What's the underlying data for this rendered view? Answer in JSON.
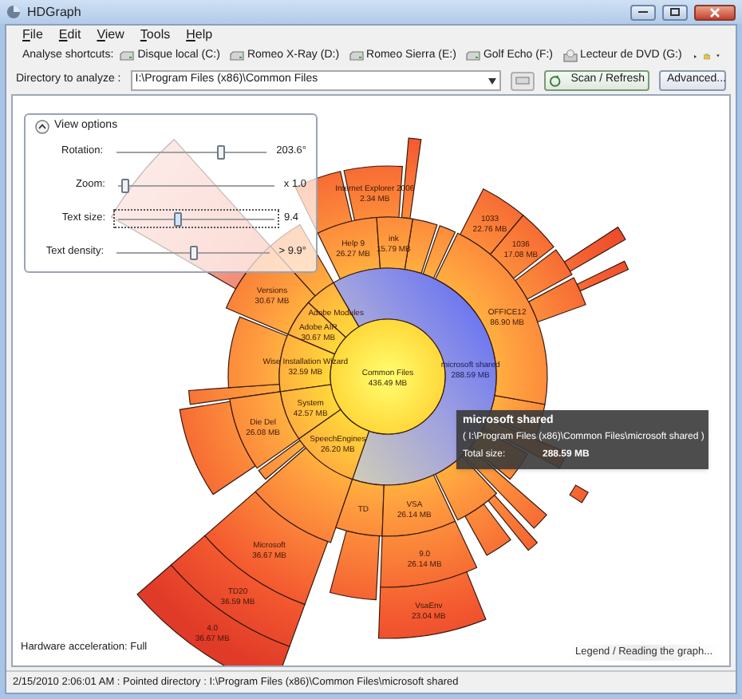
{
  "window": {
    "title": "HDGraph"
  },
  "menu": [
    {
      "label": "File"
    },
    {
      "label": "Edit"
    },
    {
      "label": "View"
    },
    {
      "label": "Tools"
    },
    {
      "label": "Help"
    }
  ],
  "shortcuts": {
    "label": "Analyse shortcuts:",
    "drives": [
      {
        "label": "Disque local (C:)",
        "kind": "disk"
      },
      {
        "label": "Romeo X-Ray (D:)",
        "kind": "disk"
      },
      {
        "label": "Romeo Sierra (E:)",
        "kind": "disk"
      },
      {
        "label": "Golf Echo (F:)",
        "kind": "disk"
      },
      {
        "label": "Lecteur de DVD (G:)",
        "kind": "dvd"
      }
    ]
  },
  "directory": {
    "label": "Directory to analyze :",
    "value": "I:\\Program Files (x86)\\Common Files"
  },
  "scan_button": "Scan / Refresh",
  "advanced_button": "Advanced...",
  "view_options": {
    "title": "View options",
    "expanded": true,
    "sliders": [
      {
        "label": "Rotation:",
        "level": 0.67,
        "reading": "203.6°",
        "focused": false
      },
      {
        "label": "Zoom:",
        "level": 0.03,
        "reading": "x 1.0",
        "focused": false
      },
      {
        "label": "Text size:",
        "level": 0.37,
        "reading": "9.4",
        "focused": true
      },
      {
        "label": "Text density:",
        "level": 0.48,
        "reading": "> 9.9°",
        "focused": false
      }
    ]
  },
  "graph": {
    "segments": [
      {
        "label": "Internet Explorer 2006",
        "size": "2.34 MB",
        "selected": false
      },
      {
        "label": "1033",
        "size": "22.76 MB",
        "selected": false
      },
      {
        "label": "Help 9",
        "size": "26.27 MB",
        "selected": false
      },
      {
        "label": "ink",
        "size": "15.79 MB",
        "selected": false
      },
      {
        "label": "1036",
        "size": "17.08 MB",
        "selected": false
      },
      {
        "label": "Versions",
        "size": "30.67 MB",
        "selected": false
      },
      {
        "label": "Adobe Modules",
        "selected": false
      },
      {
        "label": "OFFICE12",
        "size": "86.90 MB",
        "selected": false
      },
      {
        "label": "Adobe AIR",
        "size": "30.67 MB",
        "selected": false
      },
      {
        "label": "Wise Installation Wizard",
        "size": "32.59 MB",
        "selected": false
      },
      {
        "label": "microsoft shared",
        "size": "288.59 MB",
        "selected": true
      },
      {
        "label": "Common Files",
        "size": "436.49 MB",
        "selected": false
      },
      {
        "label": "System",
        "size": "42.57 MB",
        "selected": false
      },
      {
        "label": "Die Del",
        "size": "26.08 MB",
        "selected": false
      },
      {
        "label": "SpeechEngines",
        "size": "26.20 MB",
        "selected": false
      },
      {
        "label": "TD",
        "selected": false
      },
      {
        "label": "VSA",
        "size": "26.14 MB",
        "selected": false
      },
      {
        "label": "Microsoft",
        "size": "36.67 MB",
        "selected": false
      },
      {
        "label": "9.0",
        "size": "26.14 MB",
        "selected": false
      },
      {
        "label": "TD20",
        "size": "36.59 MB",
        "selected": false
      },
      {
        "label": "VsaEnv",
        "size": "23.04 MB",
        "selected": false
      },
      {
        "label": "4.0",
        "size": "36.67 MB",
        "selected": false
      }
    ]
  },
  "tooltip": {
    "title": "microsoft shared",
    "path": "( I:\\Program Files (x86)\\Common Files\\microsoft shared )",
    "total_label": "Total size:",
    "total": "288.59 MB"
  },
  "hardware_acceleration": "Hardware acceleration: Full",
  "legend_button": "Legend / Reading the graph...",
  "status_bar": "2/15/2010 2:06:01 AM : Pointed directory : I:\\Program Files (x86)\\Common Files\\microsoft shared"
}
